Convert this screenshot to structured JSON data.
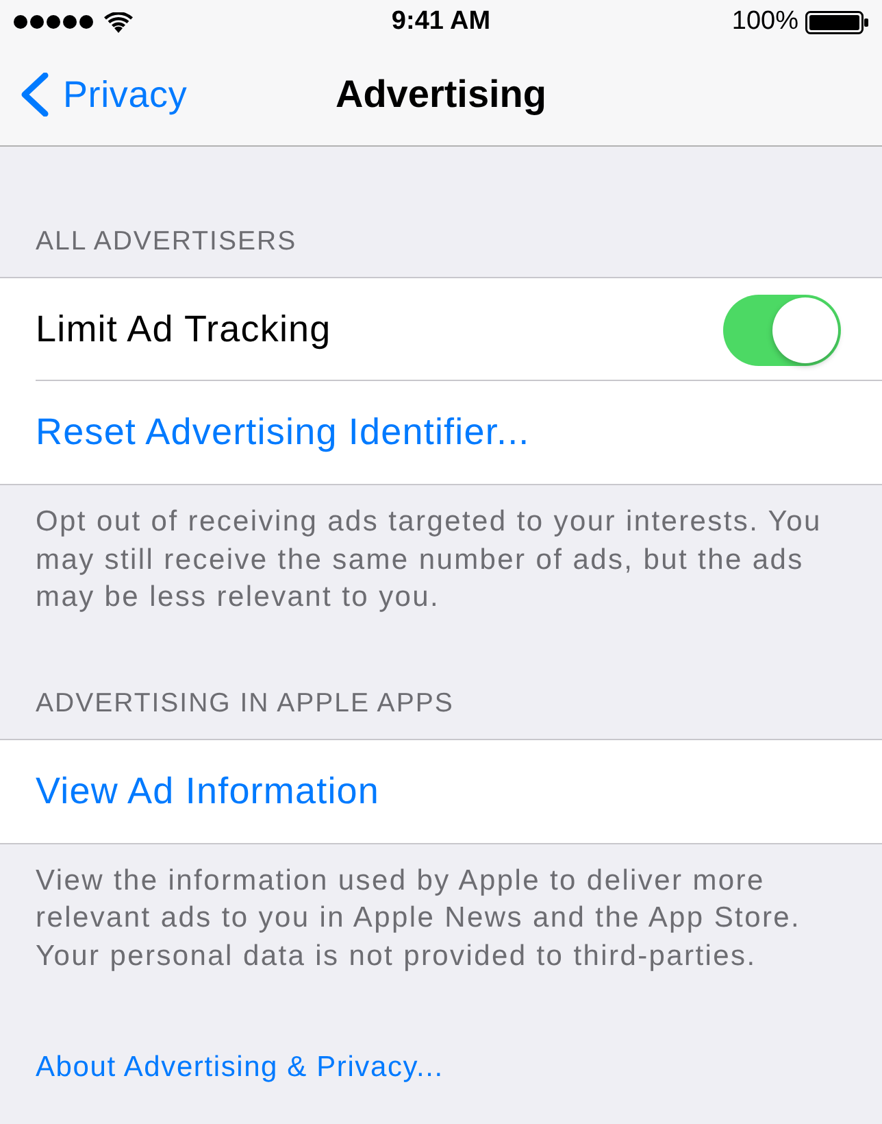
{
  "status_bar": {
    "time": "9:41 AM",
    "battery": "100%"
  },
  "nav": {
    "back": "Privacy",
    "title": "Advertising"
  },
  "sections": [
    {
      "header": "ALL ADVERTISERS",
      "rows": [
        {
          "kind": "toggle",
          "label": "Limit Ad Tracking",
          "on": true
        },
        {
          "kind": "link",
          "label": "Reset Advertising Identifier..."
        }
      ],
      "footer": "Opt out of receiving ads targeted to your interests. You may still receive the same number of ads, but the ads may be less relevant to you."
    },
    {
      "header": "ADVERTISING IN APPLE APPS",
      "rows": [
        {
          "kind": "link",
          "label": "View Ad Information"
        }
      ],
      "footer": "View the information used by Apple to deliver more relevant ads to you in Apple News and the App Store. Your personal data is not provided to third-parties."
    }
  ],
  "bottom_link": "About Advertising & Privacy..."
}
